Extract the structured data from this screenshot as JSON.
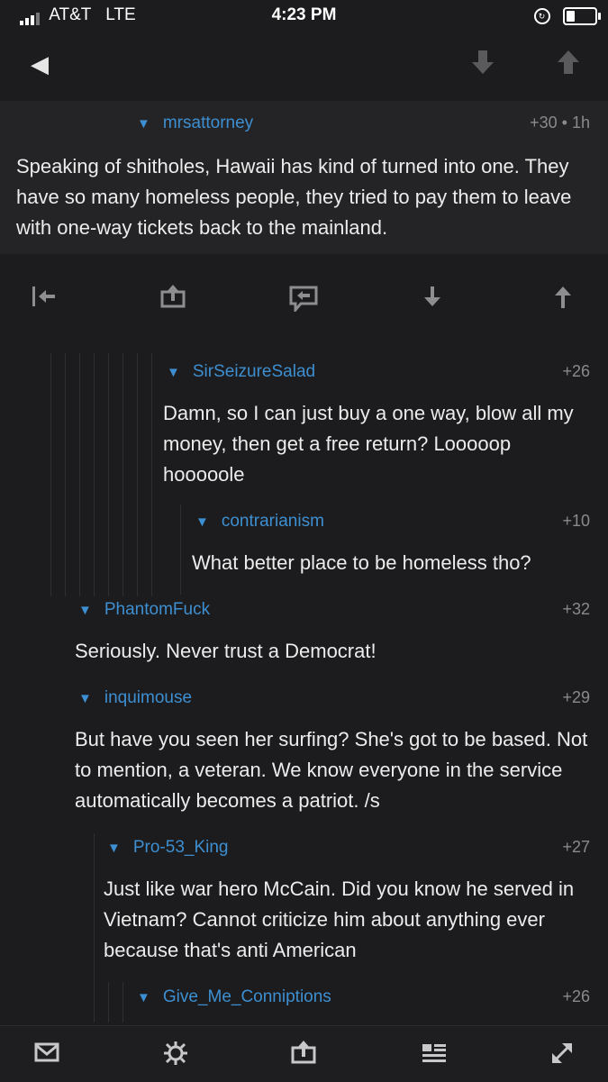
{
  "status_bar": {
    "carrier": "AT&T",
    "network": "LTE",
    "time": "4:23 PM"
  },
  "nav": {
    "back_icon": "back-arrow-icon",
    "next_icon": "down-arrow-icon",
    "prev_icon": "up-arrow-icon"
  },
  "main_comment": {
    "author": "mrsattorney",
    "meta": "+30 • 1h",
    "text": "Speaking of shitholes, Hawaii has kind of turned into one. They have so many homeless people, they tried to pay them to leave with one-way tickets back to the mainland."
  },
  "comments": [
    {
      "author": "SirSeizureSalad",
      "score": "+26",
      "text": "Damn, so I can just buy a one way, blow all my money, then get a free return?  Looooop hooooole"
    },
    {
      "author": "contrarianism",
      "score": "+10",
      "text": "What better place to be homeless tho?"
    },
    {
      "author": "PhantomFuck",
      "score": "+32",
      "text": "Seriously. Never trust a Democrat!"
    },
    {
      "author": "inquimouse",
      "score": "+29",
      "text": "But have you seen her surfing? She's got to be based. Not to mention, a veteran. We know everyone in the service automatically becomes a patriot. /s"
    },
    {
      "author": "Pro-53_King",
      "score": "+27",
      "text": "Just like war hero McCain.  Did you know he served in Vietnam?  Cannot criticize him about anything ever because that's anti American"
    },
    {
      "author": "Give_Me_Conniptions",
      "score": "+26",
      "text": ""
    }
  ],
  "colors": {
    "accent": "#3d8fd1",
    "background": "#1c1c1e",
    "text": "#ececec",
    "muted": "#8a8a8a"
  }
}
